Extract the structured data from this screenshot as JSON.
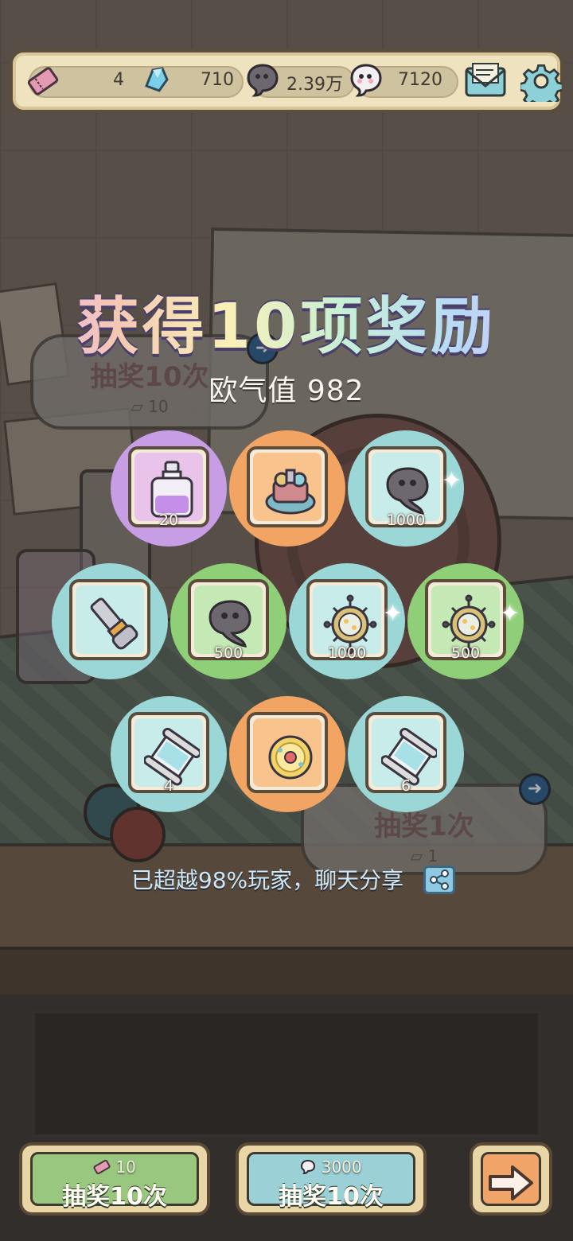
{
  "topbar": {
    "tickets": "4",
    "crystals": "710",
    "dark_bubbles": "2.39万",
    "white_bubbles": "7120",
    "icons": [
      "ticket-icon",
      "crystal-icon",
      "dark-bubble-icon",
      "white-bubble-icon",
      "mail-icon",
      "gear-icon"
    ]
  },
  "background": {
    "draw10_title": "抽奖10次",
    "draw10_cost": "10",
    "draw1_title": "抽奖1次",
    "draw1_cost": "1"
  },
  "result": {
    "title": "获得10项奖励",
    "luck_label": "欧气值 982",
    "share_text": "已超越98%玩家，聊天分享"
  },
  "rewards": [
    {
      "item": "potion-bottle",
      "rarity": "purple",
      "qty": "20"
    },
    {
      "item": "machine-parts",
      "rarity": "orange",
      "qty": ""
    },
    {
      "item": "dark-bubble",
      "rarity": "teal",
      "qty": "1000"
    },
    {
      "item": "mechanical-arm",
      "rarity": "teal",
      "qty": ""
    },
    {
      "item": "dark-bubble",
      "rarity": "green",
      "qty": "500"
    },
    {
      "item": "virus-orb",
      "rarity": "teal",
      "qty": "1000"
    },
    {
      "item": "virus-orb",
      "rarity": "green",
      "qty": "500"
    },
    {
      "item": "scroll",
      "rarity": "teal",
      "qty": "4"
    },
    {
      "item": "gold-coin",
      "rarity": "orange",
      "qty": ""
    },
    {
      "item": "scroll",
      "rarity": "teal",
      "qty": "6"
    }
  ],
  "bottom": {
    "draw10_ticket_cost": "10",
    "draw10_ticket_label": "抽奖10次",
    "draw10_bubble_cost": "3000",
    "draw10_bubble_label": "抽奖10次"
  },
  "colors": {
    "purple": "#c79de6",
    "orange": "#f2a463",
    "teal": "#9ad7d6",
    "green": "#8fcf77"
  }
}
